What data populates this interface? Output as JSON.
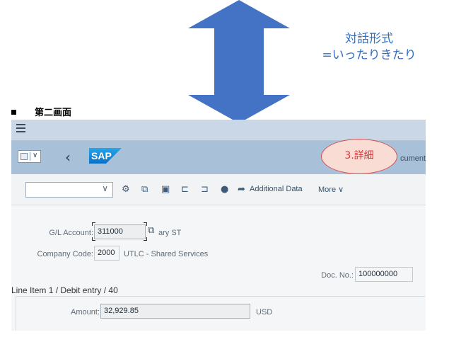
{
  "annotation": {
    "caption_line1": "対話形式",
    "caption_line2": "=いったりきたり",
    "section_title": "第二画面",
    "callout": "3.詳細",
    "arrow_color": "#4472c4"
  },
  "sap": {
    "logo": "SAP",
    "header_cut_text": "cument",
    "toolbar": {
      "dropdown_value": "",
      "icons": [
        "settings-icon",
        "copy-icon",
        "display-icon",
        "previous-icon",
        "next-icon",
        "user-icon",
        "attachment-icon"
      ],
      "additional_data": "Additional Data",
      "more": "More"
    },
    "fields": {
      "gl_account_label": "G/L Account:",
      "gl_account_value": "311000",
      "gl_account_desc": "ary ST",
      "company_code_label": "Company Code:",
      "company_code_value": "2000",
      "company_code_desc": "UTLC - Shared Services",
      "doc_no_label": "Doc. No.:",
      "doc_no_value": "100000000"
    },
    "line_item": {
      "title": "Line Item 1 / Debit entry / 40",
      "amount_label": "Amount:",
      "amount_value": "32,929.85",
      "currency": "USD"
    }
  },
  "colors": {
    "shell": "#c9d7e6",
    "header": "#a9c0d9",
    "callout_border": "#d55050"
  }
}
